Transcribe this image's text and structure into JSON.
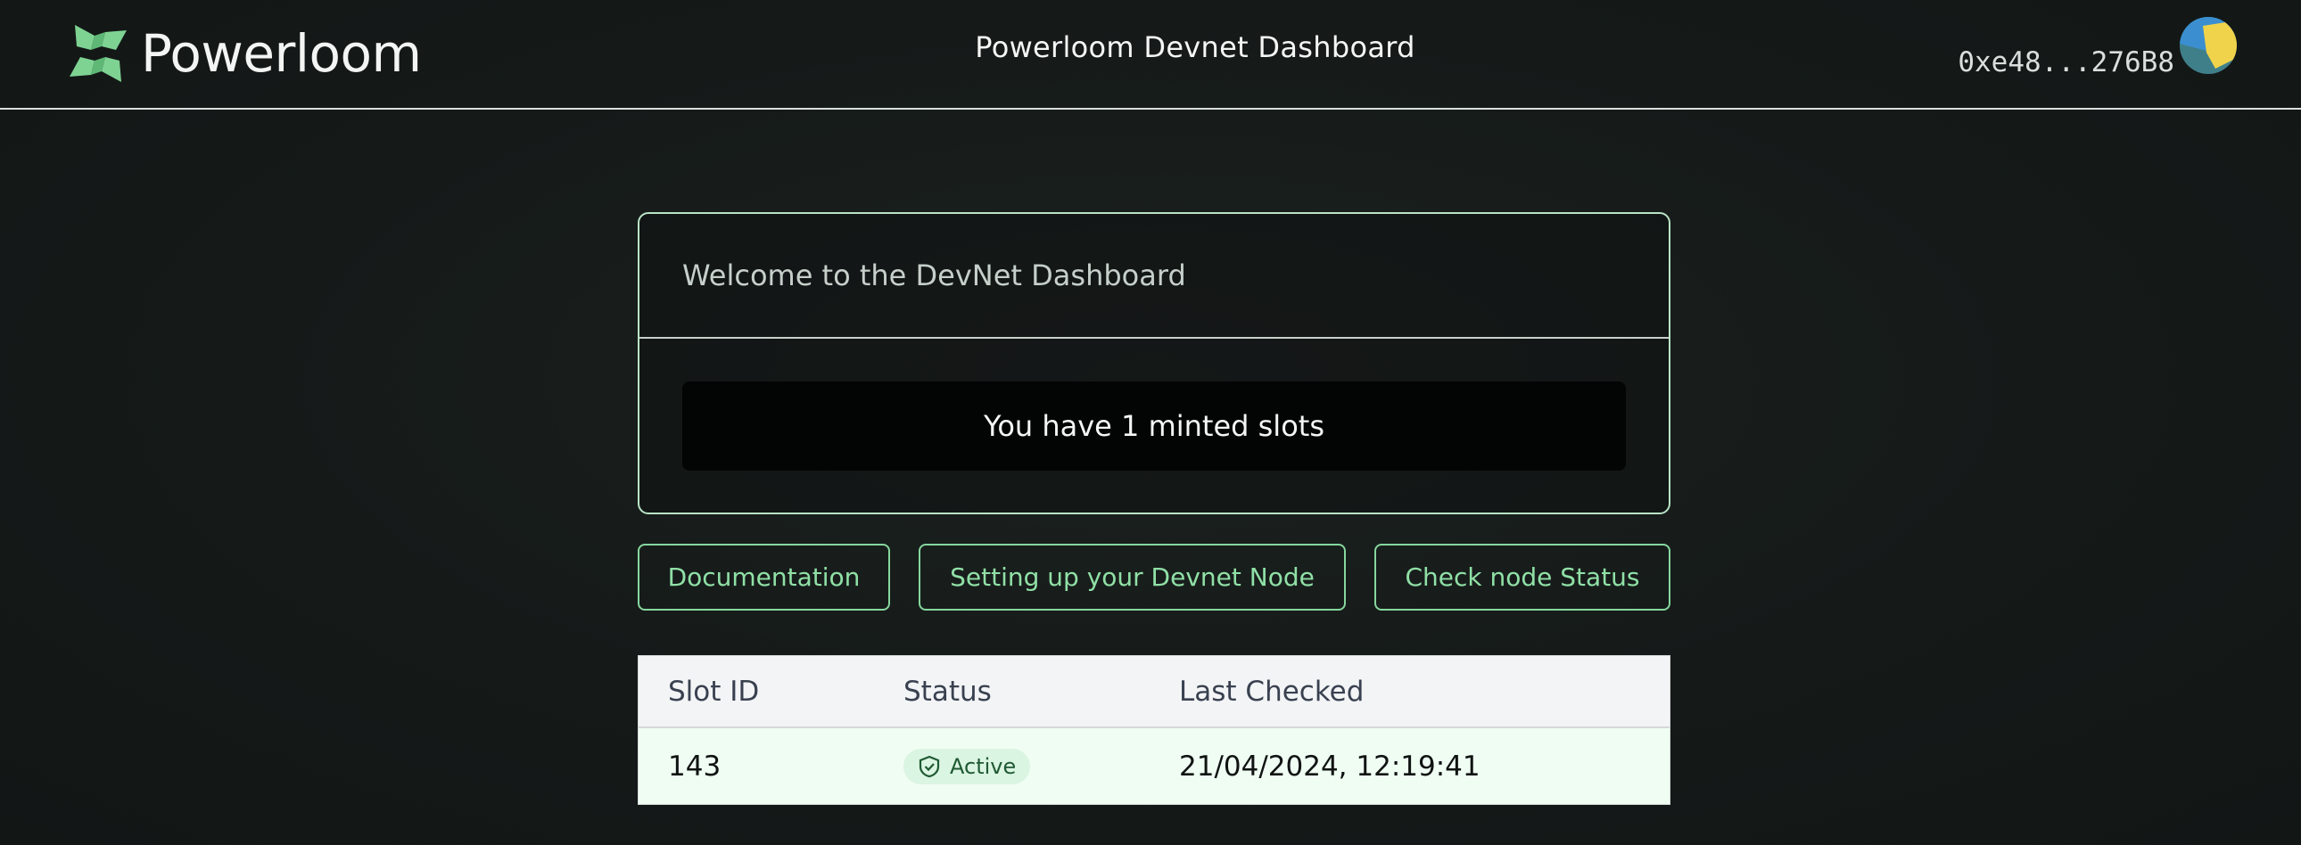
{
  "header": {
    "logo_text": "Powerloom",
    "title": "Powerloom Devnet Dashboard",
    "wallet_address": "0xe48...276B8"
  },
  "welcome": {
    "title": "Welcome to the DevNet Dashboard",
    "slots_message": "You have 1 minted slots"
  },
  "actions": {
    "documentation": "Documentation",
    "setup_node": "Setting up your Devnet Node",
    "check_status": "Check node Status"
  },
  "table": {
    "columns": [
      "Slot ID",
      "Status",
      "Last Checked"
    ],
    "rows": [
      {
        "slot_id": "143",
        "status": "Active",
        "last_checked": "21/04/2024, 12:19:41"
      }
    ]
  },
  "colors": {
    "brand_green": "#7ed393",
    "button_border": "#86d79e",
    "status_badge_bg": "#daf5e1"
  }
}
